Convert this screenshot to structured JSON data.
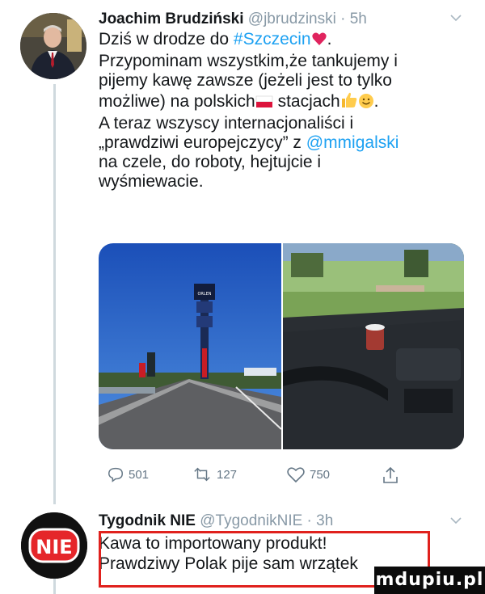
{
  "tweet1": {
    "author_name": "Joachim Brudziński",
    "handle": "@jbrudzinski",
    "separator": " · ",
    "time": "5h",
    "line1_pre": "Dziś w drodze do ",
    "hashtag": "#Szczecin",
    "line1_post": ".",
    "line2": "Przypominam wszystkim,że tankujemy i",
    "line3": "pijemy kawę zawsze (jeżeli jest to tylko",
    "line4_pre": "możliwe) na polskich",
    "line4_post": " stacjach",
    "line4_end": ".",
    "line5": "A teraz wszyscy internacjonaliści i",
    "line6_pre": "„prawdziwi europejczycy” z ",
    "mention": "@mmigalski",
    "line7": "na czele, do roboty, hejtujcie i",
    "line8": "wyśmiewacie.",
    "reply_count": "501",
    "retweet_count": "127",
    "like_count": "750"
  },
  "tweet2": {
    "author_name": "Tygodnik NIE",
    "handle": "@TygodnikNIE",
    "separator": " · ",
    "time": "3h",
    "avatar_text": "NIE",
    "line1": "Kawa to importowany produkt!",
    "line2": "Prawdziwy Polak pije sam wrzątek"
  },
  "photo_sign_text": "ORLEN",
  "watermark": "mdupiu.pl",
  "colors": {
    "link": "#1da1f2",
    "muted": "#8899a6",
    "highlight_border": "#e0211d",
    "thread_line": "#cfd9de"
  },
  "icons": [
    "reply-icon",
    "retweet-icon",
    "like-icon",
    "share-icon",
    "chevron-down-icon",
    "heart-emoji",
    "polish-flag-emoji",
    "thumbs-up-emoji",
    "smile-emoji"
  ]
}
